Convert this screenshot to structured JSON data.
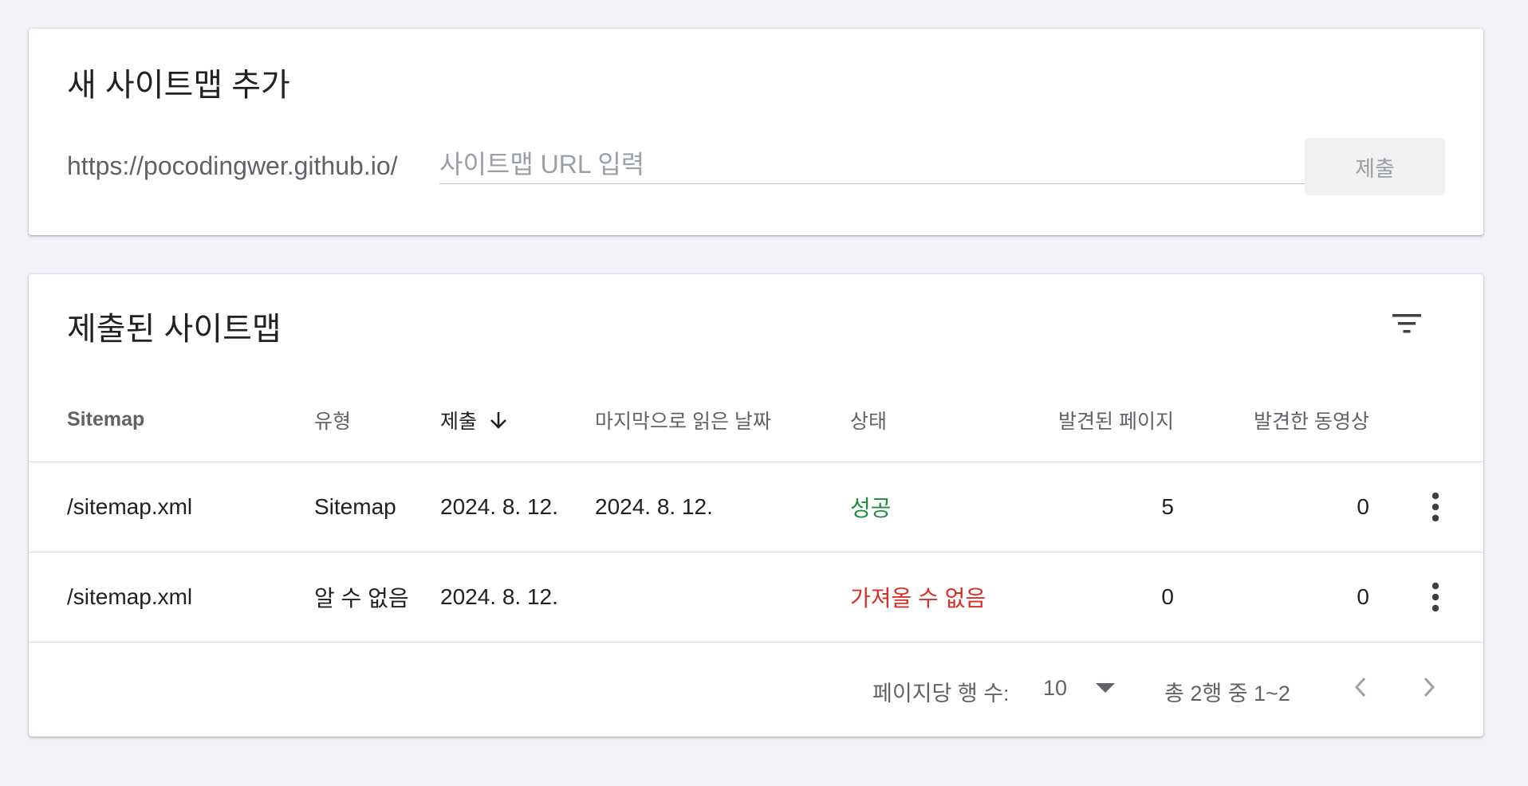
{
  "add_sitemap": {
    "title": "새 사이트맵 추가",
    "url_prefix": "https://pocodingwer.github.io/",
    "input_value": "",
    "input_placeholder": "사이트맵 URL 입력",
    "submit_label": "제출"
  },
  "submitted_sitemaps": {
    "title": "제출된 사이트맵",
    "filter_icon": "filter-icon",
    "columns": {
      "sitemap": "Sitemap",
      "type": "유형",
      "submitted": "제출",
      "last_read": "마지막으로 읽은 날짜",
      "status": "상태",
      "discovered_pages": "발견된 페이지",
      "discovered_videos": "발견한 동영상"
    },
    "sort": {
      "column": "submitted",
      "direction": "descending",
      "icon": "arrow-down-icon"
    },
    "rows": [
      {
        "sitemap": "/sitemap.xml",
        "type": "Sitemap",
        "submitted": "2024. 8. 12.",
        "last_read": "2024. 8. 12.",
        "status": "성공",
        "discovered_pages": "5",
        "discovered_videos": "0"
      },
      {
        "sitemap": "/sitemap.xml",
        "type": "알 수 없음",
        "submitted": "2024. 8. 12.",
        "last_read": "",
        "status": "가져올 수 없음",
        "discovered_pages": "0",
        "discovered_videos": "0"
      }
    ],
    "row_menu_icon": "more-vert-icon"
  },
  "pagination": {
    "rows_per_page_label": "페이지당 행 수:",
    "rows_per_page_value": "10",
    "range_label": "총 2행 중 1~2",
    "prev_icon": "chevron-left-icon",
    "next_icon": "chevron-right-icon"
  },
  "colors": {
    "background": "#f1f3f8",
    "card": "#ffffff",
    "status_success": "#1e8e3e",
    "status_error": "#d93025",
    "muted_text": "#5f6368",
    "disabled_button_bg": "#f1f1f1"
  }
}
